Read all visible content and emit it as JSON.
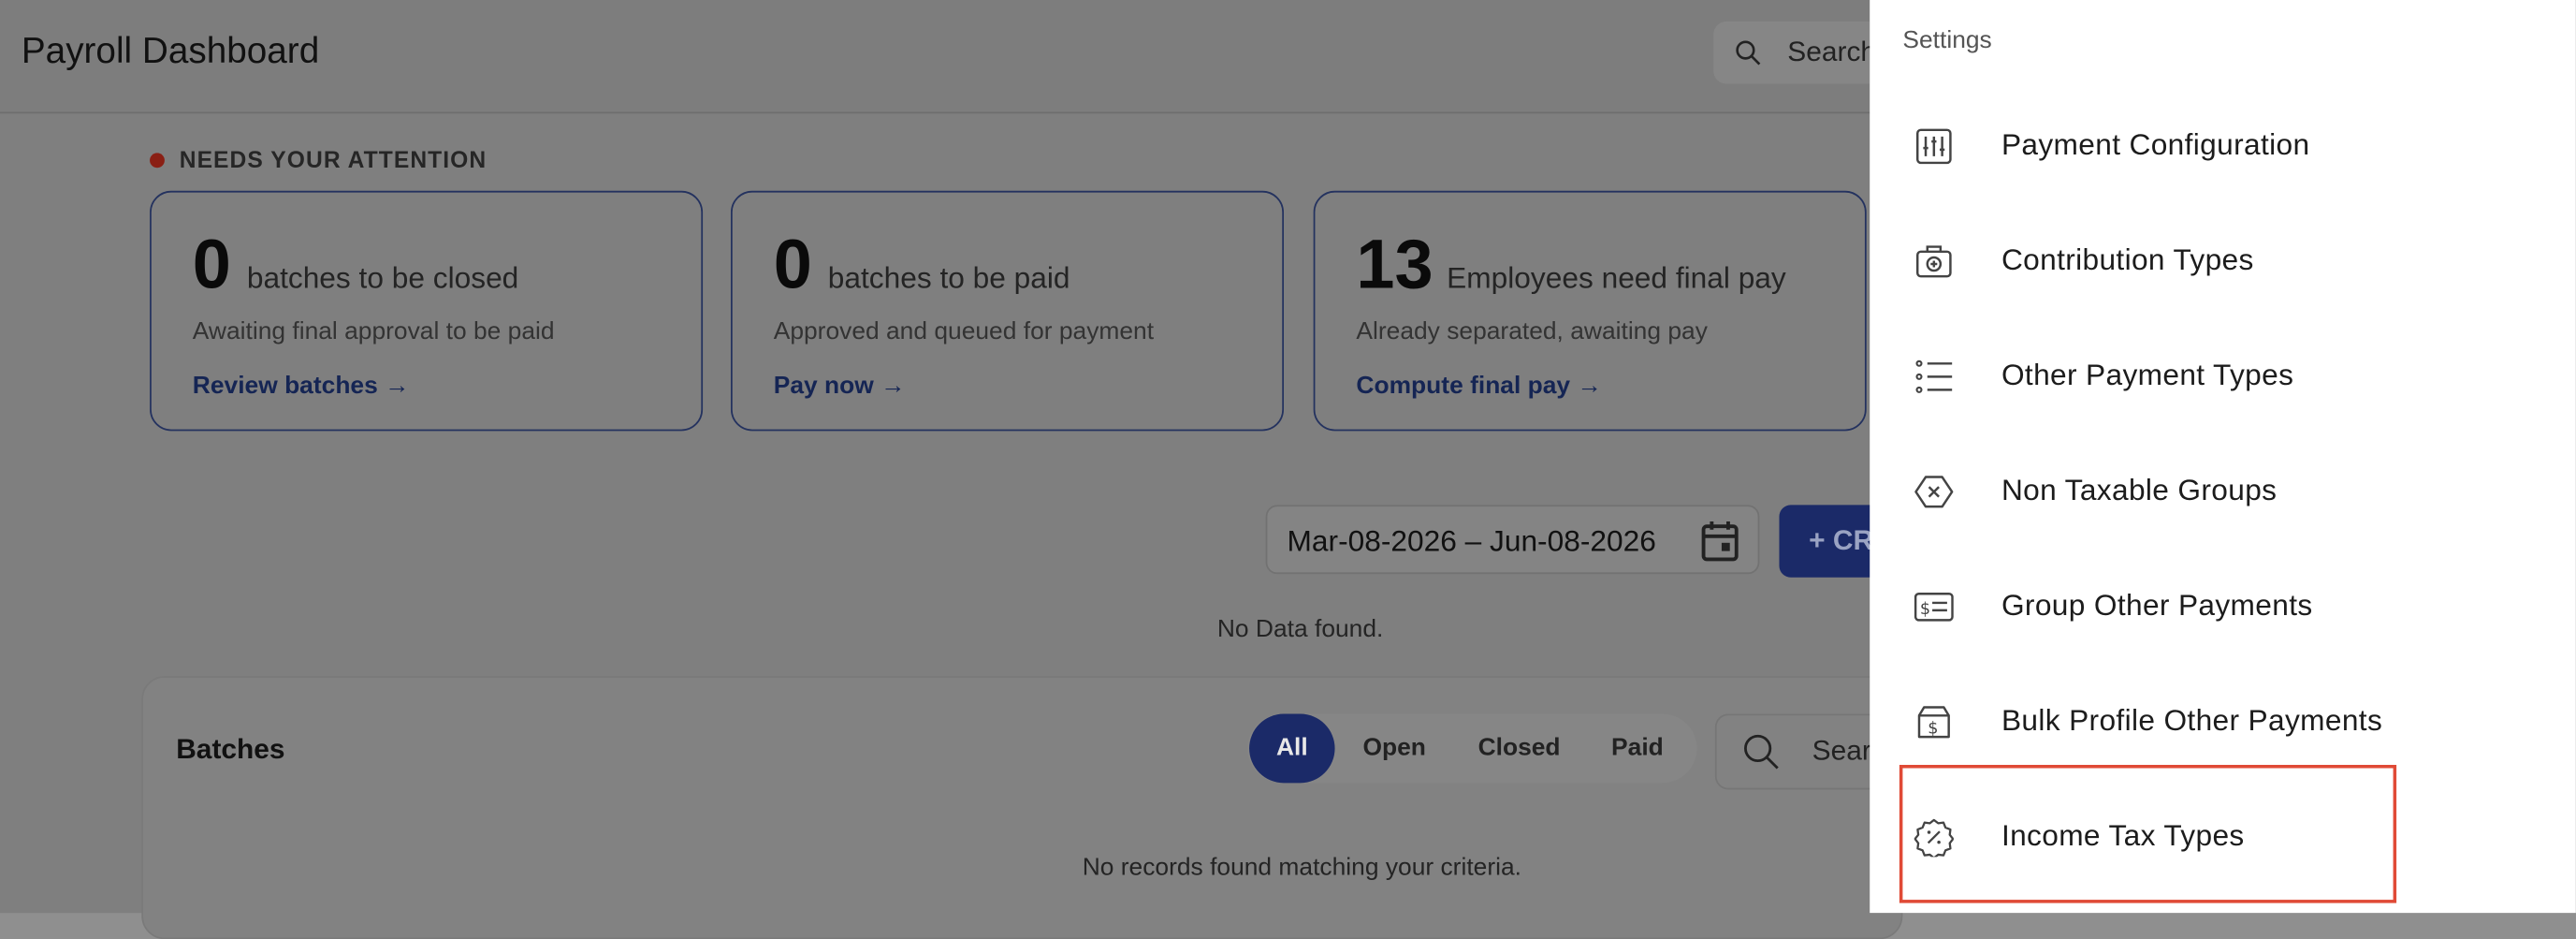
{
  "header": {
    "title": "Payroll Dashboard",
    "search_placeholder": "Search"
  },
  "attention": {
    "label": "NEEDS YOUR ATTENTION",
    "cards": [
      {
        "count": "0",
        "unit": "batches to be closed",
        "sub": "Awaiting final approval to be paid",
        "link": "Review batches →"
      },
      {
        "count": "0",
        "unit": "batches to be paid",
        "sub": "Approved and queued for payment",
        "link": "Pay now →"
      },
      {
        "count": "13",
        "unit": "Employees need final pay",
        "sub": "Already separated, awaiting pay",
        "link": "Compute final pay →"
      }
    ]
  },
  "date_range": "Mar-08-2026 – Jun-08-2026",
  "create_label": "+ CR",
  "no_data": "No Data found.",
  "batches": {
    "title": "Batches",
    "filters": [
      "All",
      "Open",
      "Closed",
      "Paid"
    ],
    "active_filter": "All",
    "search_placeholder": "Sear",
    "empty": "No records found matching your criteria."
  },
  "settings": {
    "title": "Settings",
    "items": [
      {
        "label": "Payment Configuration",
        "icon": "sliders-icon"
      },
      {
        "label": "Contribution Types",
        "icon": "medical-kit-icon"
      },
      {
        "label": "Other Payment Types",
        "icon": "list-icon"
      },
      {
        "label": "Non Taxable Groups",
        "icon": "hexagon-x-icon"
      },
      {
        "label": "Group Other Payments",
        "icon": "dollar-card-icon"
      },
      {
        "label": "Bulk Profile Other Payments",
        "icon": "dollar-box-icon"
      },
      {
        "label": "Income Tax Types",
        "icon": "percent-badge-icon"
      }
    ],
    "highlighted": "Income Tax Types",
    "highlight_color": "#e04a36"
  },
  "colors": {
    "primary": "#1b2a68",
    "overlay": "#7f7f7f"
  }
}
